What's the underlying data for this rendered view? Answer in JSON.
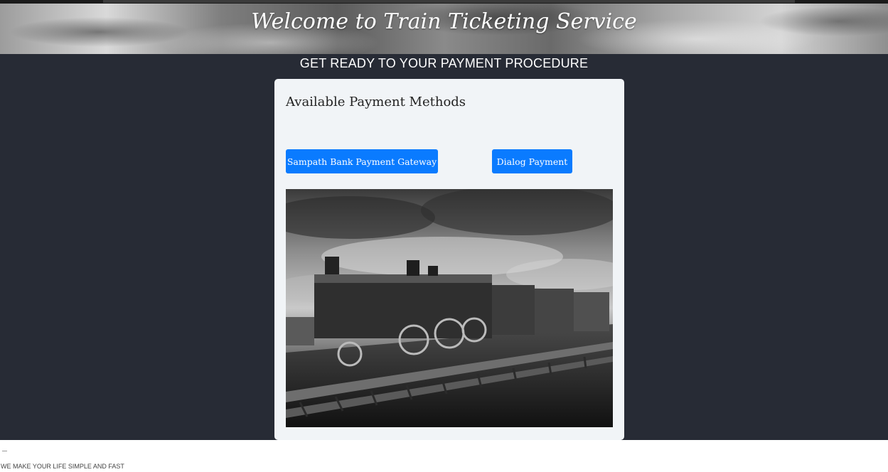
{
  "header": {
    "title": "Welcome to Train Ticketing Service"
  },
  "main": {
    "subtitle": "GET READY TO YOUR PAYMENT PROCEDURE",
    "card": {
      "title": "Available Payment Methods",
      "buttons": {
        "sampath": "Sampath Bank Payment Gateway",
        "dialog": "Dialog Payment"
      },
      "image": "steam-locomotive-photo"
    }
  },
  "footer": {
    "tagline": "WE MAKE YOUR LIFE SIMPLE AND FAST"
  },
  "colors": {
    "background_dark": "#272b35",
    "card_bg": "#f1f4f7",
    "button_blue": "#0a7bff"
  }
}
